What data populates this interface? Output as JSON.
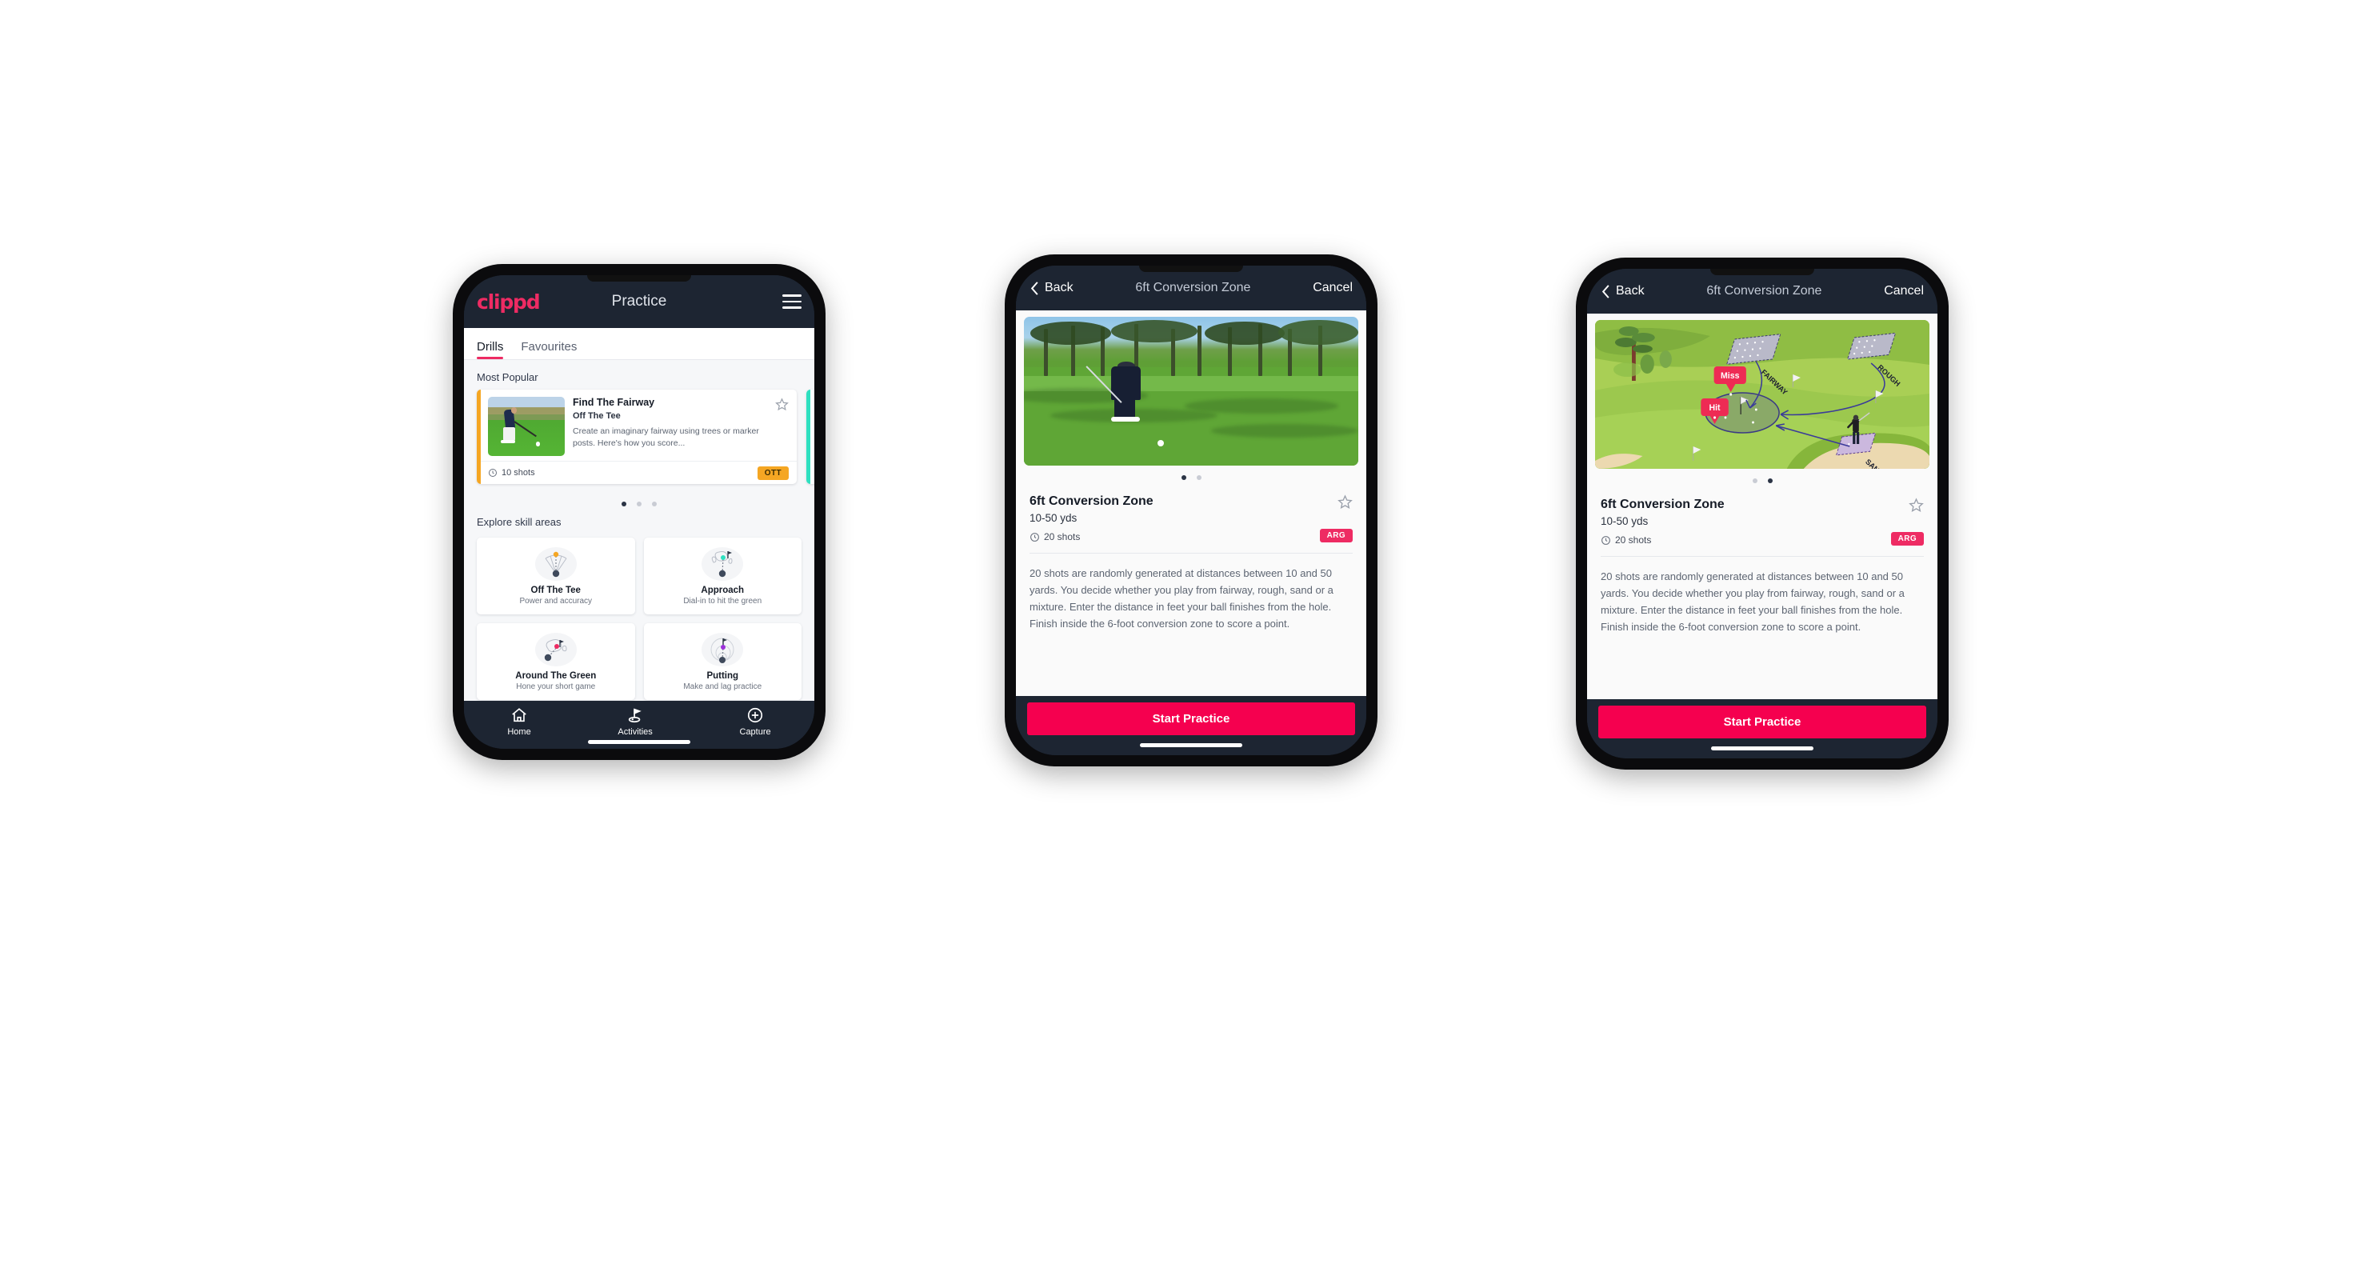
{
  "app": {
    "brand": "clippd",
    "accent_pink": "#ee2b63",
    "accent_cta": "#f5004f",
    "header_bg": "#1d2532",
    "ott_yellow": "#f5a623",
    "teal": "#2fe0c0"
  },
  "phone1": {
    "header": {
      "logo": "clippd",
      "title": "Practice",
      "menu_icon": "hamburger-icon"
    },
    "tabs": [
      {
        "label": "Drills",
        "active": true
      },
      {
        "label": "Favourites",
        "active": false
      }
    ],
    "most_popular": {
      "section_label": "Most Popular",
      "card": {
        "title": "Find The Fairway",
        "subtitle": "Off The Tee",
        "description": "Create an imaginary fairway using trees or marker posts. Here's how you score...",
        "shots": "10 shots",
        "badge": "OTT",
        "accent": "#f5a623",
        "favourite_icon": "star-outline-icon",
        "shots_icon": "clock-icon"
      },
      "peek_card_accent": "#2fe0c0",
      "dots": {
        "count": 3,
        "active": 0
      }
    },
    "explore": {
      "section_label": "Explore skill areas",
      "items": [
        {
          "name": "Off The Tee",
          "sub": "Power and accuracy",
          "icon": "tee-fan-icon",
          "dot_color": "#f5a623"
        },
        {
          "name": "Approach",
          "sub": "Dial-in to hit the green",
          "icon": "green-approach-icon",
          "dot_color": "#2fe0c0"
        },
        {
          "name": "Around The Green",
          "sub": "Hone your short game",
          "icon": "chip-icon",
          "dot_color": "#ee2b63"
        },
        {
          "name": "Putting",
          "sub": "Make and lag practice",
          "icon": "putting-rings-icon",
          "dot_color": "#9b30d9"
        }
      ]
    },
    "nav": [
      {
        "label": "Home",
        "icon": "home-icon",
        "active": false
      },
      {
        "label": "Activities",
        "icon": "golf-flag-icon",
        "active": true
      },
      {
        "label": "Capture",
        "icon": "plus-circle-icon",
        "active": false
      }
    ]
  },
  "phone2": {
    "header": {
      "back": "Back",
      "title": "6ft Conversion Zone",
      "cancel": "Cancel",
      "back_icon": "chevron-left-icon"
    },
    "hero": {
      "type": "photo",
      "alt": "golfer chipping on pine-lined course"
    },
    "dots": {
      "count": 2,
      "active": 0
    },
    "detail": {
      "title": "6ft Conversion Zone",
      "distance": "10-50 yds",
      "shots": "20 shots",
      "badge": "ARG",
      "favourite_icon": "star-outline-icon",
      "shots_icon": "clock-icon",
      "description": "20 shots are randomly generated at distances between 10 and 50 yards. You decide whether you play from fairway, rough, sand or a mixture. Enter the distance in feet your ball finishes from the hole. Finish inside the 6-foot conversion zone to score a point."
    },
    "cta": "Start Practice"
  },
  "phone3": {
    "header": {
      "back": "Back",
      "title": "6ft Conversion Zone",
      "cancel": "Cancel",
      "back_icon": "chevron-left-icon"
    },
    "hero": {
      "type": "illustration",
      "labels": {
        "fairway": "FAIRWAY",
        "rough": "ROUGH",
        "sand": "SAND"
      },
      "markers": {
        "miss": "Miss",
        "hit": "Hit"
      }
    },
    "dots": {
      "count": 2,
      "active": 1
    },
    "detail": {
      "title": "6ft Conversion Zone",
      "distance": "10-50 yds",
      "shots": "20 shots",
      "badge": "ARG",
      "favourite_icon": "star-outline-icon",
      "shots_icon": "clock-icon",
      "description": "20 shots are randomly generated at distances between 10 and 50 yards. You decide whether you play from fairway, rough, sand or a mixture. Enter the distance in feet your ball finishes from the hole. Finish inside the 6-foot conversion zone to score a point."
    },
    "cta": "Start Practice"
  }
}
